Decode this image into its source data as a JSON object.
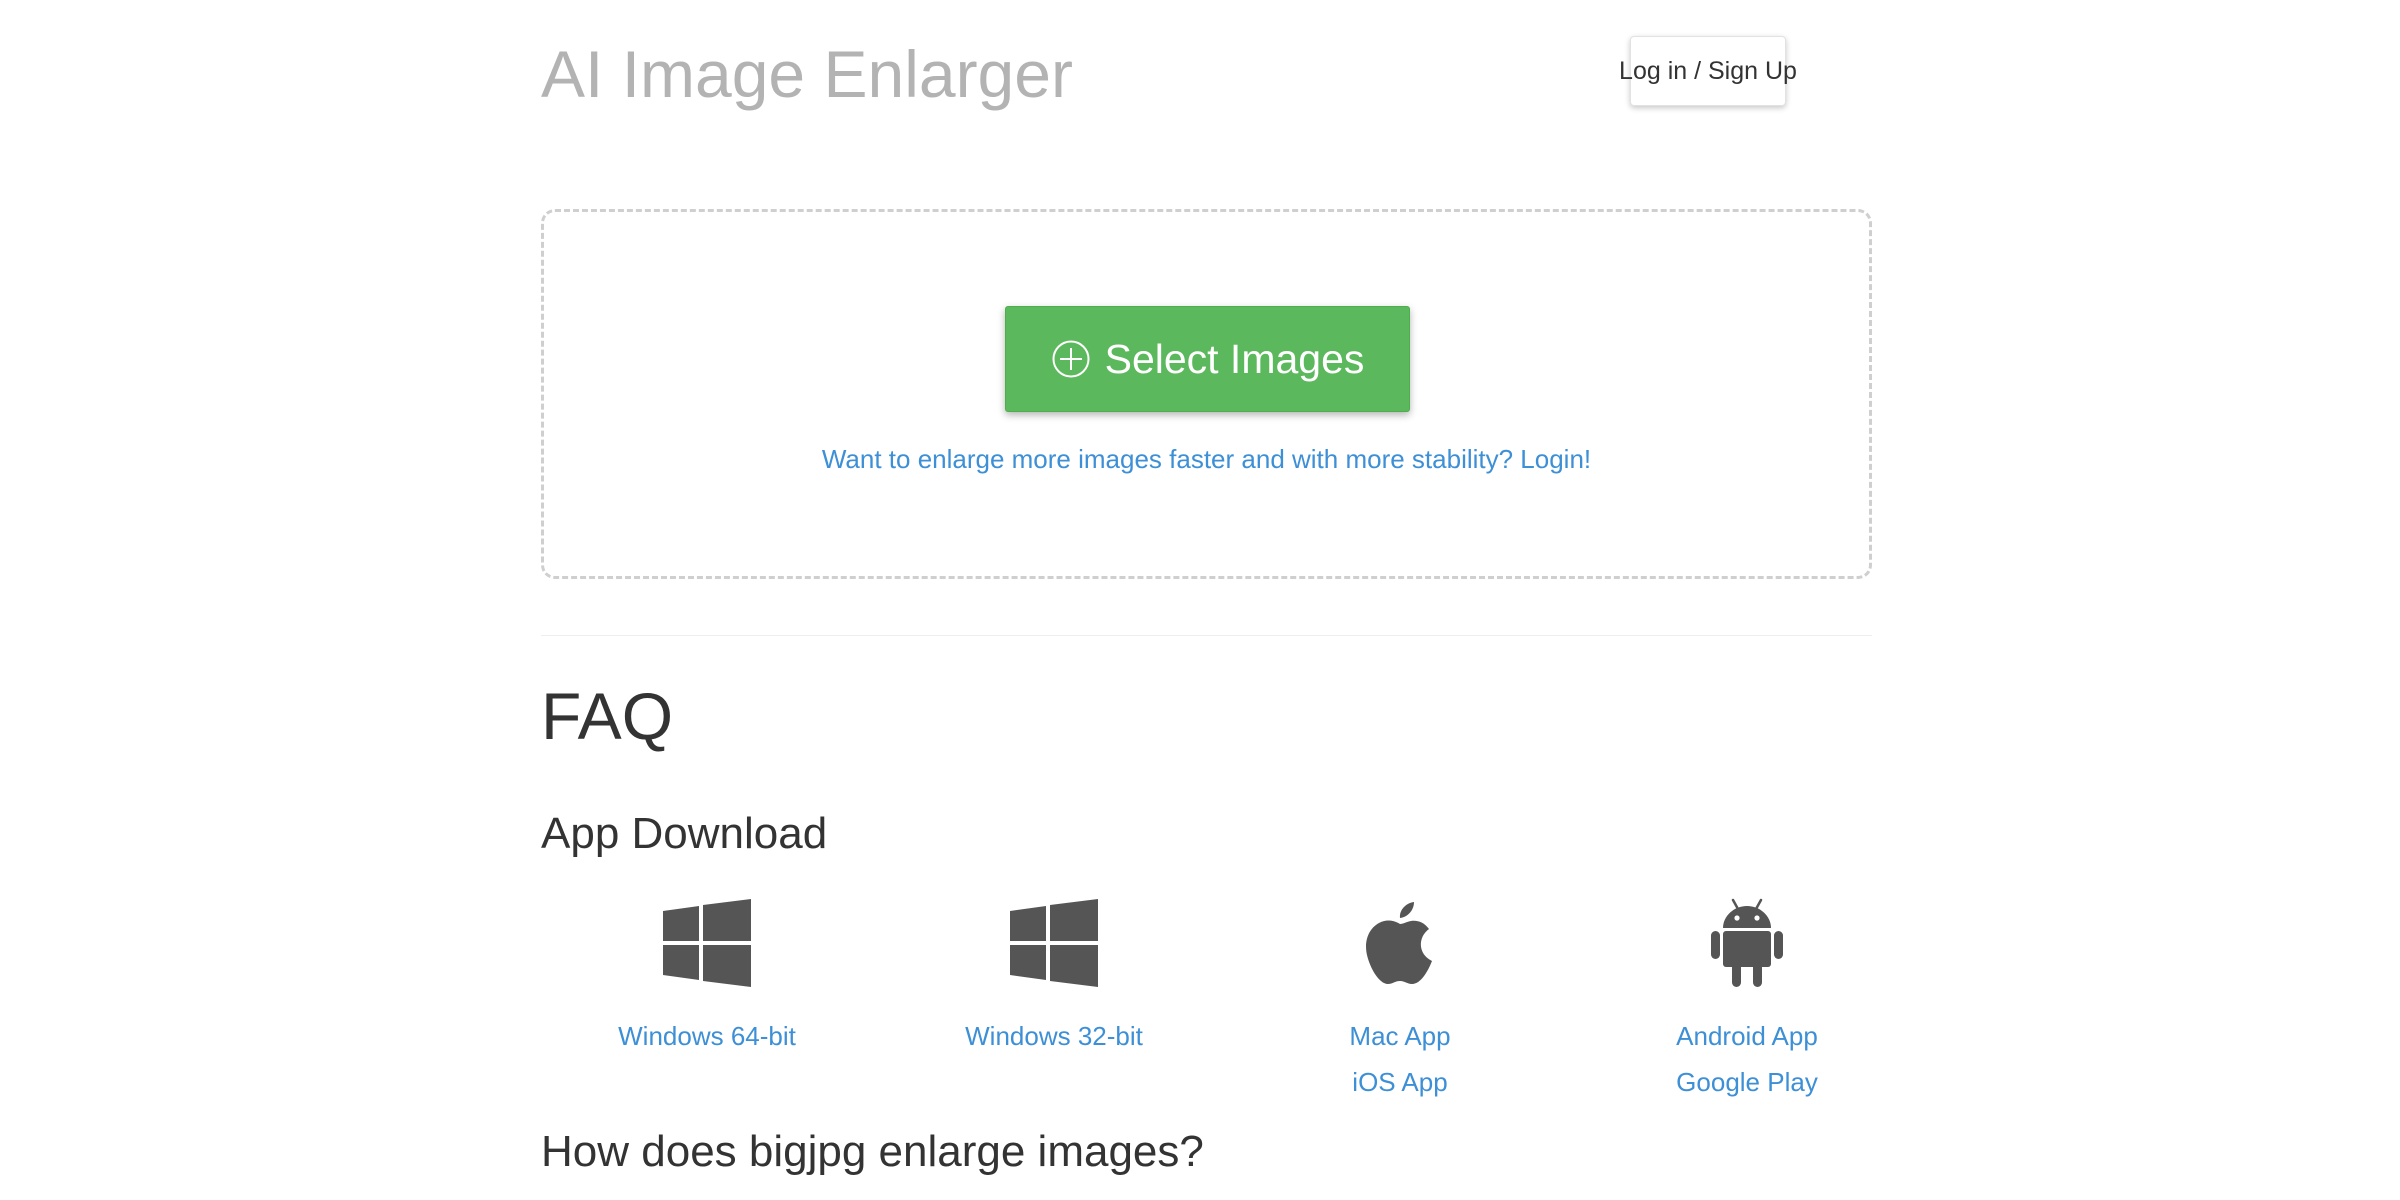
{
  "header": {
    "title": "AI Image Enlarger",
    "login_label": "Log in / Sign Up"
  },
  "upload": {
    "select_label": "Select Images",
    "login_hint": "Want to enlarge more images faster and with more stability? Login!"
  },
  "faq": {
    "title": "FAQ",
    "app_download_title": "App Download",
    "apps": [
      {
        "icon": "windows-icon",
        "links": [
          "Windows 64-bit"
        ]
      },
      {
        "icon": "windows-icon",
        "links": [
          "Windows 32-bit"
        ]
      },
      {
        "icon": "apple-icon",
        "links": [
          "Mac App",
          "iOS App"
        ]
      },
      {
        "icon": "android-icon",
        "links": [
          "Android App",
          "Google Play"
        ]
      }
    ],
    "how_title": "How does bigjpg enlarge images?"
  },
  "colors": {
    "accent_green": "#5cb85c",
    "link_blue": "#3d8fd6",
    "title_gray": "#b3b3b3",
    "icon_gray": "#555555"
  }
}
